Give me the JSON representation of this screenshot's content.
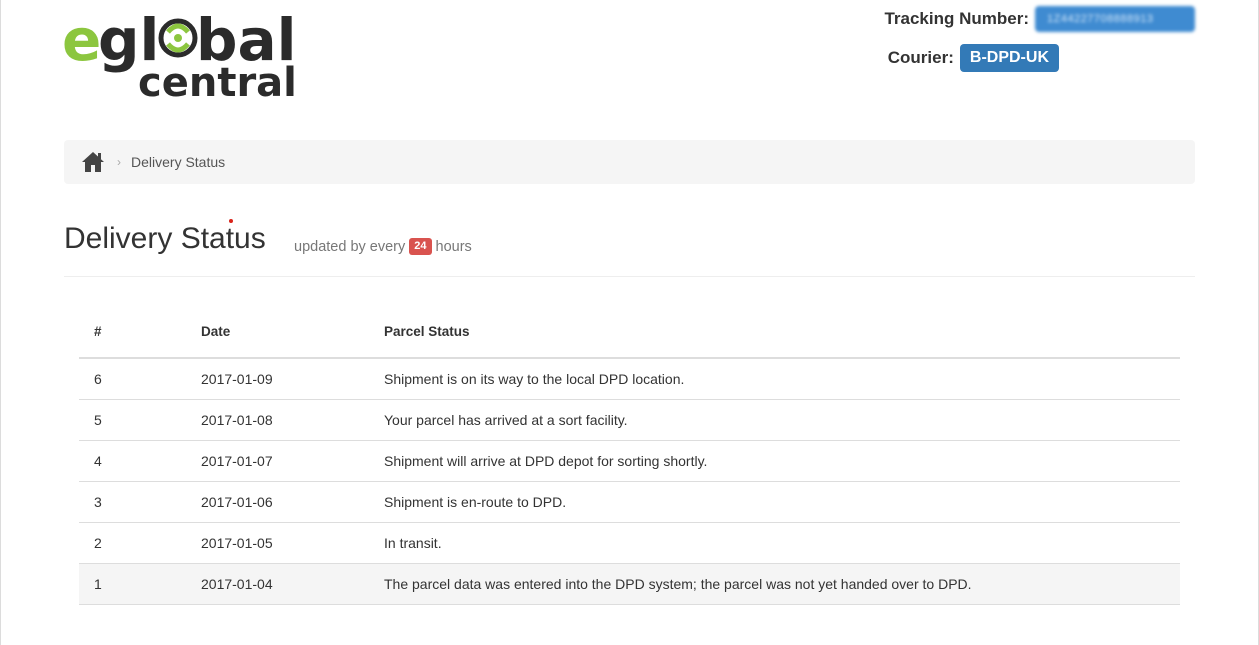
{
  "logo": {
    "text_top": "eglobal",
    "text_bottom": "central",
    "colors": {
      "green": "#8cc63f",
      "dark": "#2b2b2b"
    }
  },
  "tracking": {
    "label": "Tracking Number:",
    "number": "1Z44227708888913"
  },
  "courier": {
    "label": "Courier:",
    "value": "B-DPD-UK",
    "badge_color": "#337ab7"
  },
  "breadcrumb": {
    "home_icon": "home-icon",
    "separator": "›",
    "current": "Delivery Status"
  },
  "header": {
    "title": "Delivery Status",
    "subtitle_prefix": "updated by every",
    "hours": "24",
    "subtitle_suffix": "hours",
    "badge_color": "#d9534f"
  },
  "table": {
    "columns": [
      "#",
      "Date",
      "Parcel Status"
    ],
    "rows": [
      {
        "num": "6",
        "date": "2017-01-09",
        "status": "Shipment is on its way to the local DPD location."
      },
      {
        "num": "5",
        "date": "2017-01-08",
        "status": "Your parcel has arrived at a sort facility."
      },
      {
        "num": "4",
        "date": "2017-01-07",
        "status": "Shipment will arrive at DPD depot for sorting shortly."
      },
      {
        "num": "3",
        "date": "2017-01-06",
        "status": "Shipment is en-route to DPD."
      },
      {
        "num": "2",
        "date": "2017-01-05",
        "status": "In transit."
      },
      {
        "num": "1",
        "date": "2017-01-04",
        "status": "The parcel data was entered into the DPD system; the parcel was not yet handed over to DPD."
      }
    ]
  }
}
